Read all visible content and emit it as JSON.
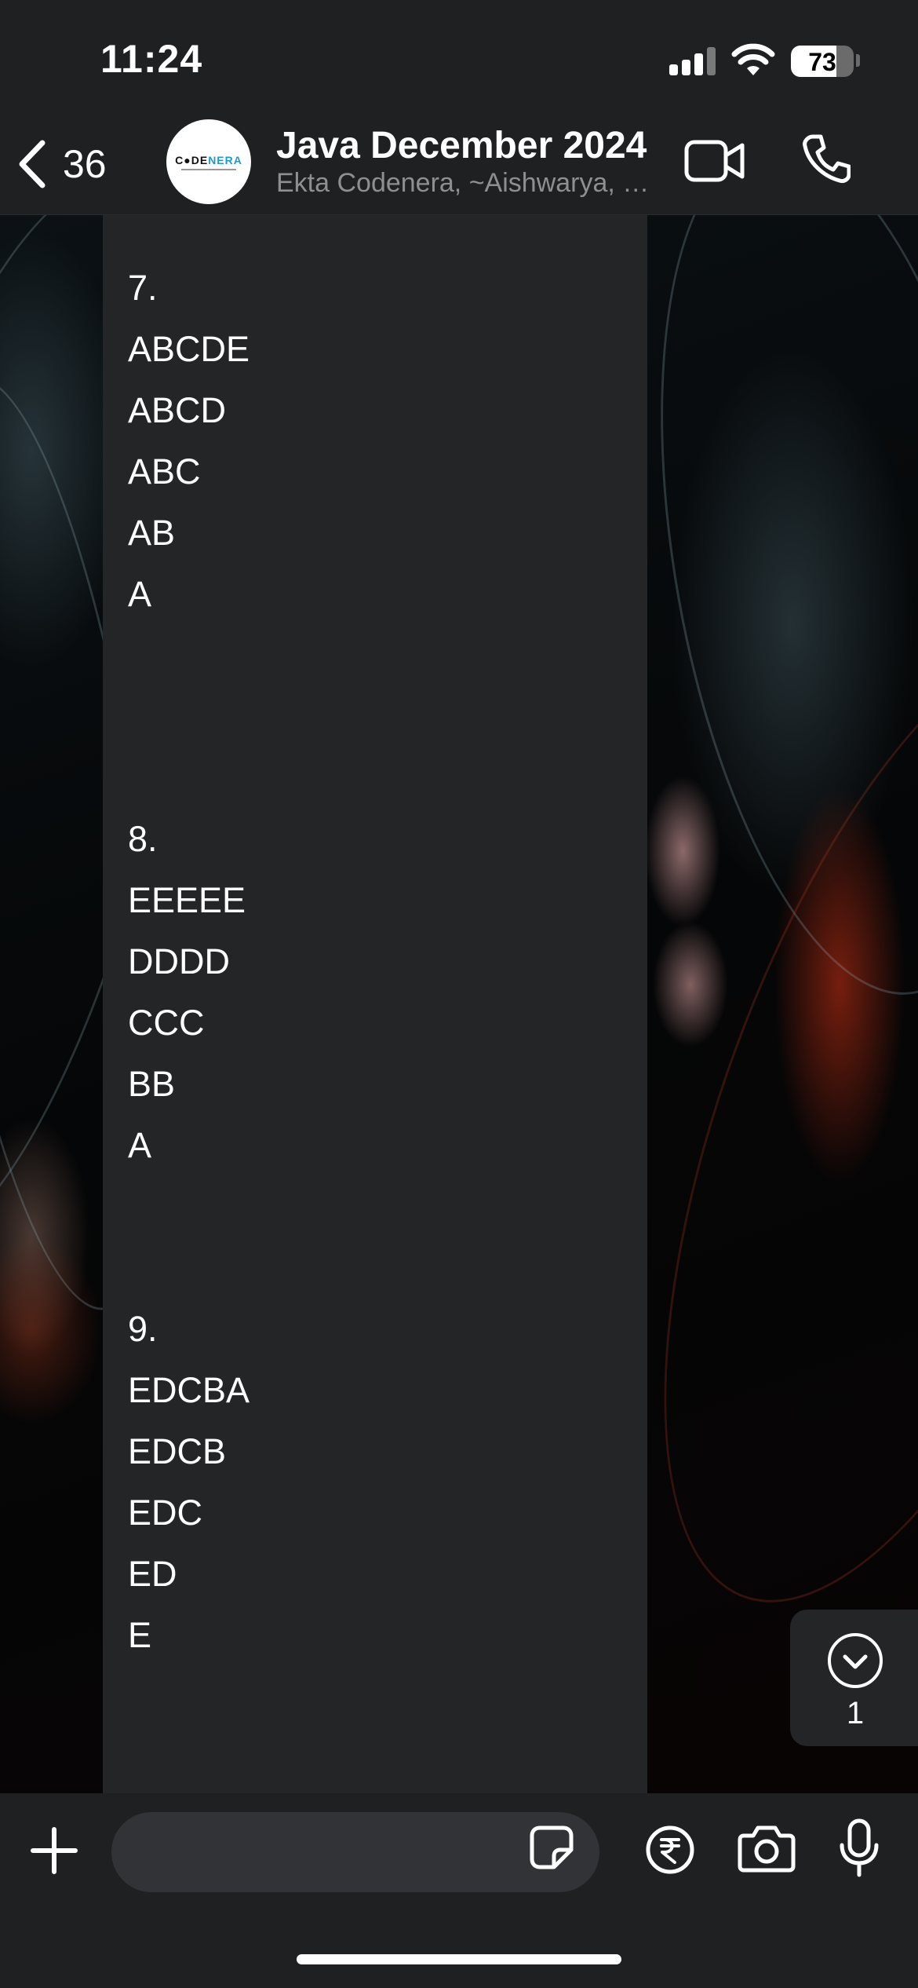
{
  "status_bar": {
    "time": "11:24",
    "battery_percent": "73"
  },
  "header": {
    "back_count": "36",
    "avatar_logo_prefix": "C",
    "avatar_logo_mid": "DE",
    "avatar_logo_suffix": "NERA",
    "title": "Java December 2024",
    "subtitle": "Ekta Codenera, ~Aishwarya, ~Ankit, ~Ritesh"
  },
  "message": {
    "lines": [
      "7.",
      "ABCDE",
      "ABCD",
      "ABC",
      "AB",
      "A",
      "8.",
      "EEEEE",
      "DDDD",
      "CCC",
      "BB",
      "A",
      "9.",
      "EDCBA",
      "EDCB",
      "EDC",
      "ED",
      "E"
    ]
  },
  "scroll_badge": {
    "unread_count": "1"
  },
  "input_bar": {
    "placeholder": ""
  },
  "icons": {
    "back": "chevron-left-icon",
    "video": "video-camera-icon",
    "call": "phone-icon",
    "plus": "plus-icon",
    "sticker": "sticker-icon",
    "payment": "rupee-icon",
    "camera": "camera-icon",
    "mic": "microphone-icon",
    "scroll": "chevron-down-icon"
  }
}
